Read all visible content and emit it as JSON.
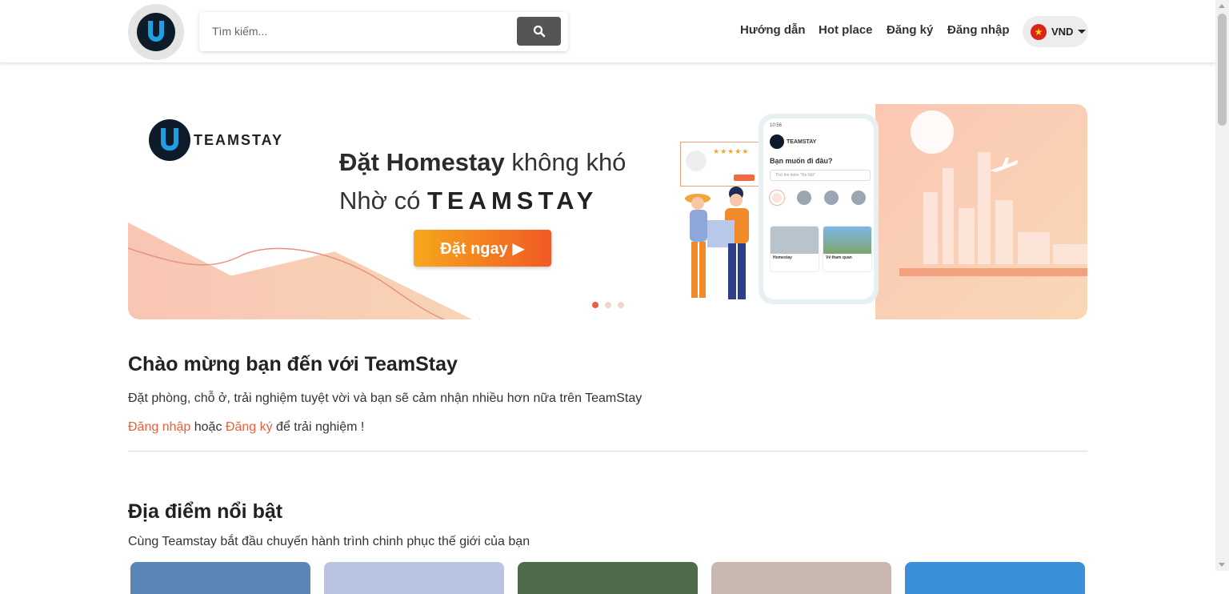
{
  "header": {
    "search_placeholder": "Tìm kiếm...",
    "nav": [
      "Hướng dẫn",
      "Hot place",
      "Đăng ký",
      "Đăng nhập"
    ],
    "currency": "VND",
    "flag_star": "★"
  },
  "banner": {
    "brand": "TEAMSTAY",
    "headline_bold": "Đặt Homestay",
    "headline_rest": " không khó",
    "line2_prefix": "Nhờ có ",
    "line2_brand": "TEAMSTAY",
    "cta": "Đặt ngay ▶",
    "phone": {
      "time": "10:56",
      "brand": "TEAMSTAY",
      "question": "Bạn muốn đi đâu?",
      "search": "Thử tìm kiếm \"Hà Nội\"",
      "cards": [
        "Homestay",
        "Vé tham quan"
      ]
    },
    "slide_active": 1,
    "slide_count": 3
  },
  "welcome": {
    "title": "Chào mừng bạn đến với TeamStay",
    "description": "Đặt phòng, chỗ ở, trải nghiệm tuyệt vời và bạn sẽ cảm nhận nhiều hơn nữa trên TeamStay",
    "login_link": "Đăng nhập",
    "or_text": " hoặc ",
    "register_link": "Đăng ký",
    "suffix": " để trải nghiệm !"
  },
  "places": {
    "title": "Địa điểm nổi bật",
    "subtitle": "Cùng Teamstay bắt đầu chuyến hành trình chinh phục thế giới của bạn",
    "card_colors": [
      "#5d86b8",
      "#b9c3e4",
      "#4f6b4c",
      "#c9b8b0",
      "#3b8fd8"
    ]
  },
  "colors": {
    "accent": "#ef5d3a",
    "search_button": "#555555"
  }
}
